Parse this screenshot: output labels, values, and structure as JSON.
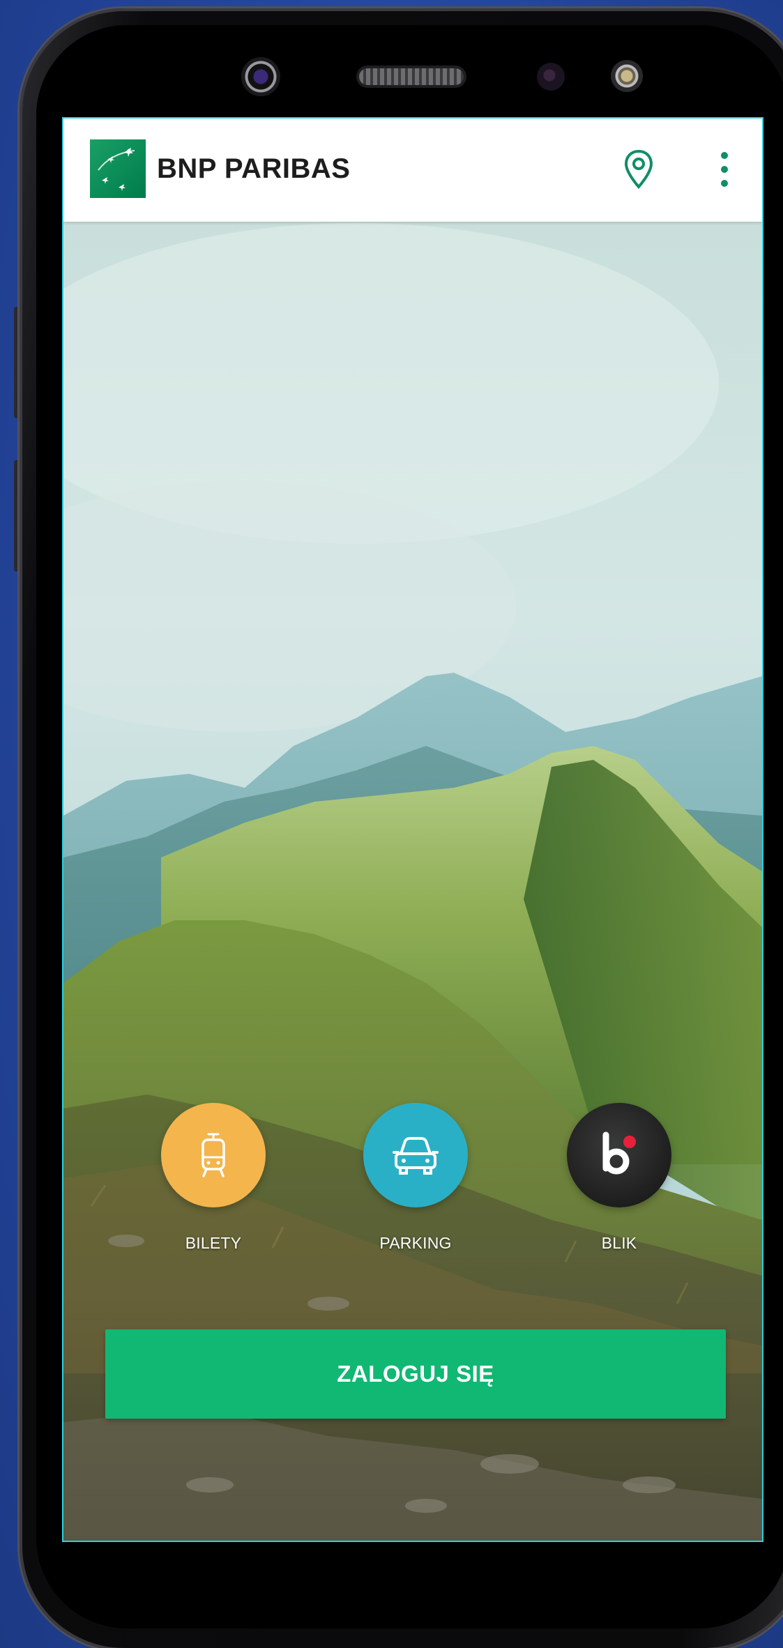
{
  "header": {
    "brand_name": "BNP PARIBAS",
    "logo_icon": "bnp-paribas-stars-logo",
    "location_icon": "map-pin-icon",
    "menu_icon": "more-vert-icon"
  },
  "quick_actions": [
    {
      "label": "BILETY",
      "icon": "tram-icon",
      "color": "#f4b54d"
    },
    {
      "label": "PARKING",
      "icon": "car-icon",
      "color": "#2ab0c6"
    },
    {
      "label": "BLIK",
      "icon": "blik-logo-icon",
      "color": "#1e1e1e"
    }
  ],
  "login": {
    "label": "ZALOGUJ SIĘ",
    "color": "#10b873"
  },
  "colors": {
    "brand_green": "#00965e",
    "accent_green": "#10b873",
    "background": "#264aa6"
  }
}
